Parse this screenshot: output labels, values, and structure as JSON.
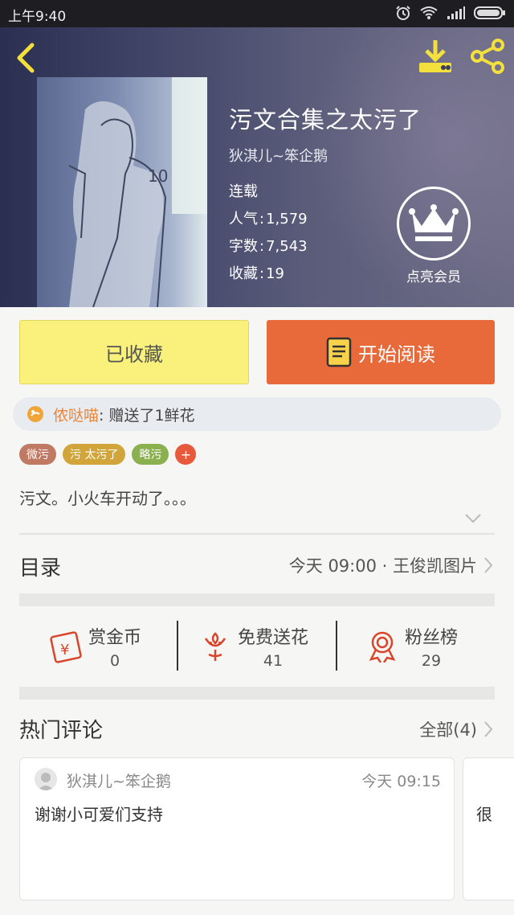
{
  "status_bar": {
    "time": "上午9:40"
  },
  "book": {
    "title": "污文合集之太污了",
    "author": "狄淇儿~笨企鹅",
    "status": "连载",
    "popularity_label": "人气",
    "popularity_value": "1,579",
    "words_label": "字数",
    "words_value": "7,543",
    "favorites_label": "收藏",
    "favorites_value": "19"
  },
  "member": {
    "label": "点亮会员"
  },
  "actions": {
    "collected_label": "已收藏",
    "read_label": "开始阅读"
  },
  "gift": {
    "user": "侬哒喵",
    "text": ": 赠送了1鲜花"
  },
  "tags": [
    {
      "label": "微污",
      "color": "#c07a63"
    },
    {
      "label": "污  太污了",
      "color": "#d1a53a"
    },
    {
      "label": "略污",
      "color": "#8ab050"
    }
  ],
  "tag_add": "+",
  "intro": "污文。小火车开动了。。。",
  "toc": {
    "title": "目录",
    "latest": "今天 09:00 · 王俊凯图片"
  },
  "stats": [
    {
      "label": "赏金币",
      "value": "0",
      "icon": "coin-envelope-icon"
    },
    {
      "label": "免费送花",
      "value": "41",
      "icon": "flower-icon"
    },
    {
      "label": "粉丝榜",
      "value": "29",
      "icon": "medal-icon"
    }
  ],
  "comments": {
    "title": "热门评论",
    "all_label": "全部(4)",
    "items": [
      {
        "user": "狄淇儿~笨企鹅",
        "time": "今天 09:15",
        "body": "谢谢小可爱们支持"
      },
      {
        "body": "很"
      }
    ]
  },
  "colors": {
    "accent_orange": "#e8693a",
    "collected_yellow": "#f9f17b",
    "icon_yellow": "#f3e03c",
    "icon_red": "#d9452b"
  }
}
